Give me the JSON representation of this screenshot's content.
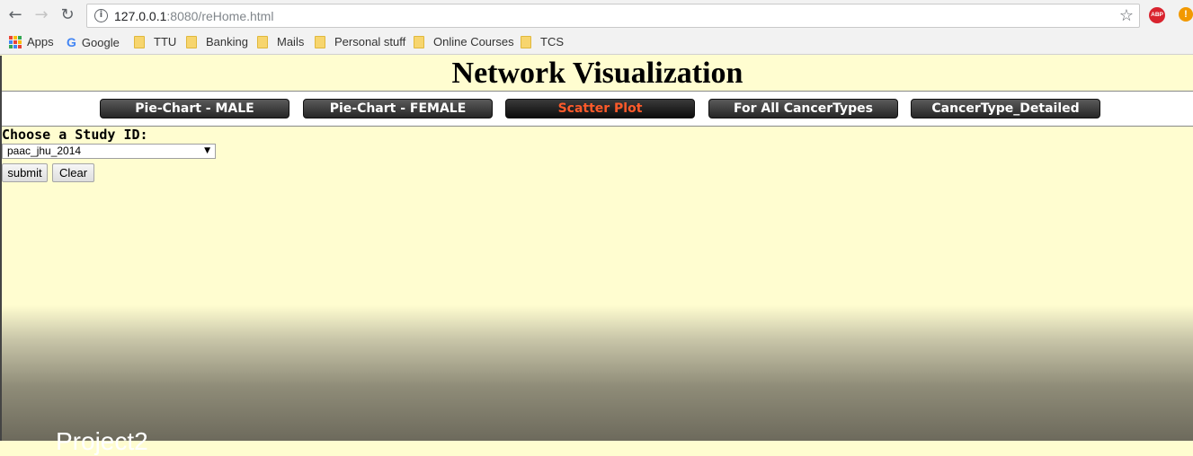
{
  "browser": {
    "url_host": "127.0.0.1",
    "url_rest": ":8080/reHome.html",
    "bookmarks": [
      "Apps",
      "Google",
      "TTU",
      "Banking",
      "Mails",
      "Personal stuff",
      "Online Courses",
      "TCS"
    ],
    "abp_label": "ABP",
    "alert_label": "!"
  },
  "page": {
    "title": "Network Visualization",
    "nav_buttons": [
      "Pie-Chart - MALE",
      "Pie-Chart - FEMALE",
      "Scatter Plot",
      "For All CancerTypes",
      "CancerType_Detailed"
    ],
    "active_nav": "Scatter Plot",
    "study_label": "Choose a Study ID:",
    "study_select_value": "paac_jhu_2014",
    "submit_label": "submit",
    "clear_label": "Clear",
    "footer_text": "Project2"
  }
}
